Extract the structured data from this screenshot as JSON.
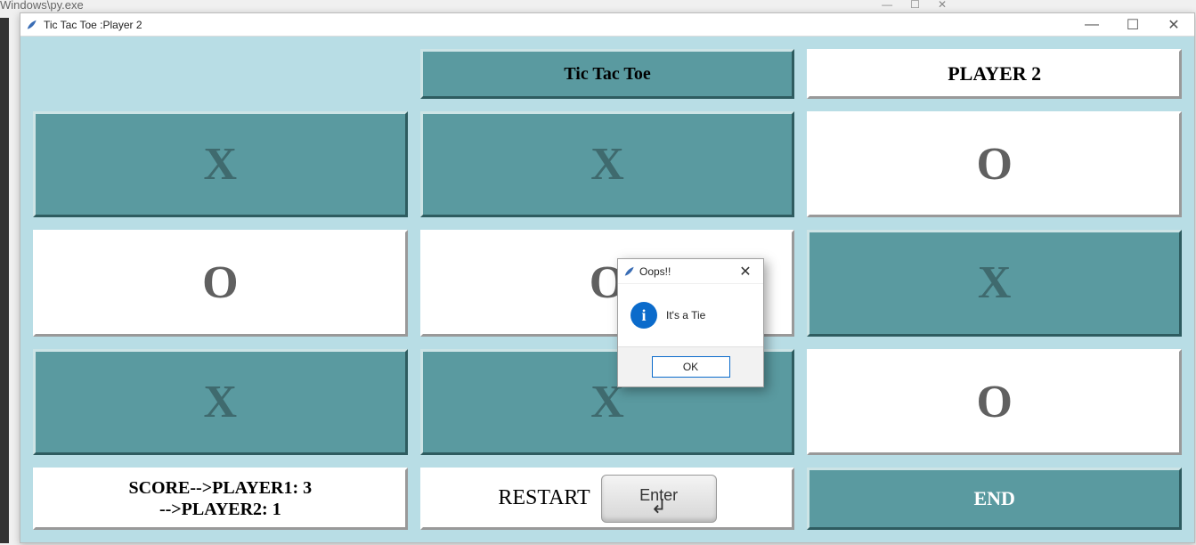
{
  "bg": {
    "path_text": "Windows\\py.exe"
  },
  "window": {
    "title": "Tic Tac Toe :Player 2",
    "controls": {
      "min": "—",
      "max": "☐",
      "close": "✕"
    }
  },
  "header": {
    "game_title": "Tic Tac Toe",
    "player_label": "PLAYER 2"
  },
  "board": {
    "cells": [
      {
        "mark": "X",
        "pressed": true
      },
      {
        "mark": "X",
        "pressed": true
      },
      {
        "mark": "O",
        "pressed": false
      },
      {
        "mark": "O",
        "pressed": false
      },
      {
        "mark": "O",
        "pressed": false
      },
      {
        "mark": "X",
        "pressed": true
      },
      {
        "mark": "X",
        "pressed": true
      },
      {
        "mark": "X",
        "pressed": true
      },
      {
        "mark": "O",
        "pressed": false
      }
    ]
  },
  "footer": {
    "score_line1": "SCORE-->PLAYER1: 3",
    "score_line2": "-->PLAYER2: 1",
    "restart_label": "RESTART",
    "enter_key": "Enter",
    "end_label": "END"
  },
  "modal": {
    "title": "Oops!!",
    "message": "It's a Tie",
    "ok": "OK"
  }
}
